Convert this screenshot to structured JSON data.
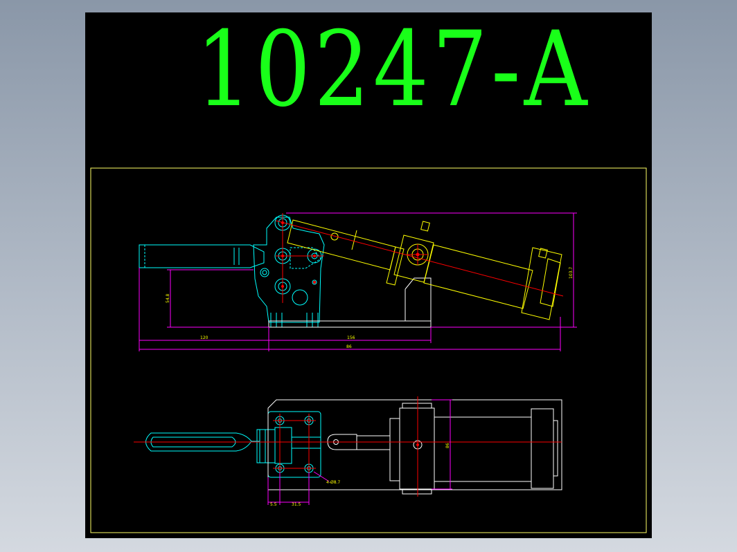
{
  "title": "10247-A",
  "colors": {
    "background": "#000000",
    "title": "#19ff19",
    "frame": "#ffff66",
    "body_outline": "#00ffff",
    "cylinder": "#ffff00",
    "dimension": "#ff00ff",
    "centerline": "#ff0000",
    "plate": "#ffffff"
  },
  "dimensions": {
    "side_height": "54.8",
    "side_width_total": "86",
    "side_left": "120",
    "side_right": "156",
    "cylinder_height": "103.7",
    "top_width": "86",
    "bottom_offset": "5.5",
    "bottom_spacing": "31.5",
    "hole_callout": "4-Ø8.7"
  }
}
